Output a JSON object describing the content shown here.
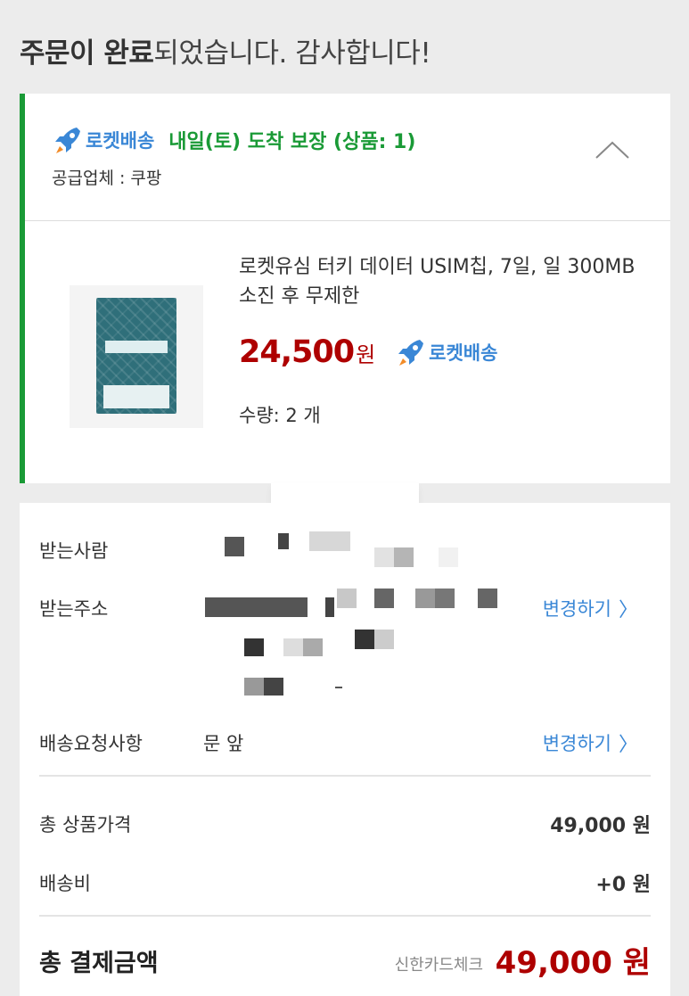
{
  "header": {
    "title_bold": "주문이 완료",
    "title_rest": "되었습니다. 감사합니다!"
  },
  "shipment": {
    "rocket_label": "로켓배송",
    "promise": "내일(토) 도착 보장 (상품: 1)",
    "supplier": "공급업체 : 쿠팡",
    "icons": {
      "rocket": "rocket-icon",
      "collapse": "chevron-up-icon"
    }
  },
  "product": {
    "name": "로켓유심 터키 데이터 USIM칩, 7일, 일 300MB 소진 후 무제한",
    "price": "24,500",
    "currency": "원",
    "delivery_badge": "로켓배송",
    "quantity": "수량: 2 개"
  },
  "delivery": {
    "recipient_label": "받는사람",
    "address_label": "받는주소",
    "request_label": "배송요청사항",
    "request_value": "문 앞",
    "change_label": "변경하기",
    "chevron": "〉"
  },
  "payment": {
    "subtotal_label": "총 상품가격",
    "subtotal_value": "49,000 원",
    "shipping_label": "배송비",
    "shipping_value": "+0 원",
    "total_label": "총 결제금액",
    "card_name": "신한카드체크",
    "total_value": "49,000 원"
  },
  "colors": {
    "accent_green": "#1a9a36",
    "rocket_blue": "#3a87d6",
    "price_red": "#ae0000"
  }
}
